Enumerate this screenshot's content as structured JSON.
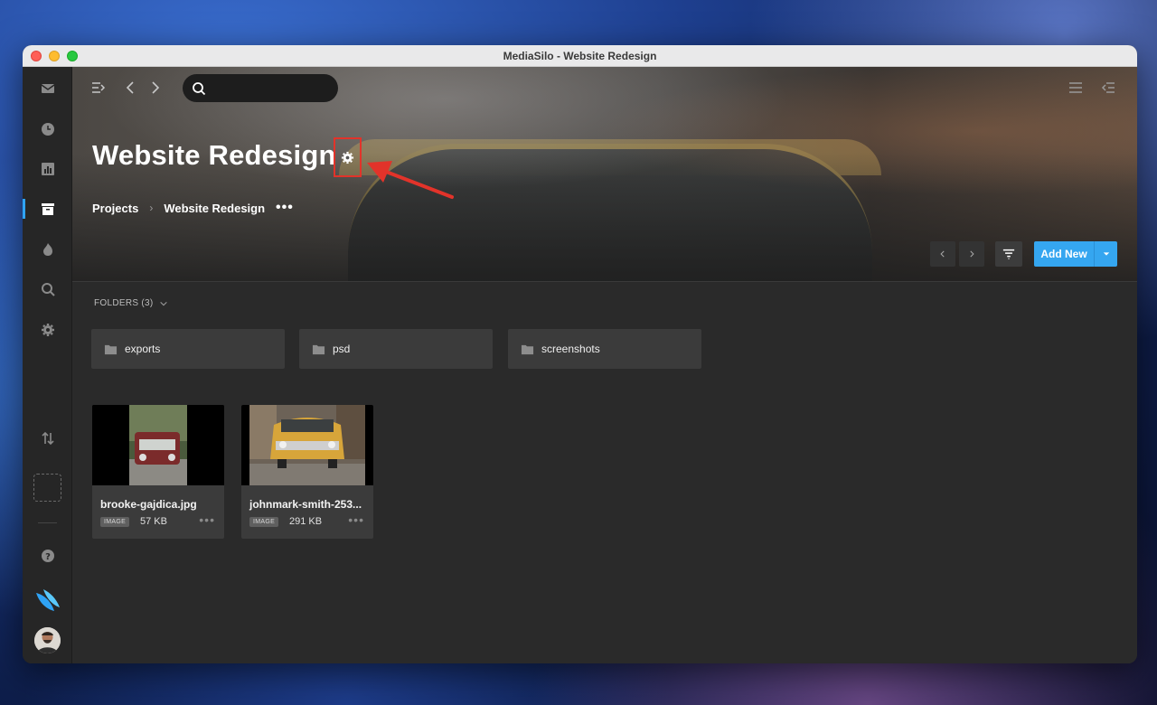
{
  "window": {
    "title": "MediaSilo - Website Redesign"
  },
  "sidebar": {
    "items": [
      {
        "icon": "inbox-icon"
      },
      {
        "icon": "clock-icon"
      },
      {
        "icon": "chart-icon"
      },
      {
        "icon": "projects-icon",
        "active": true
      },
      {
        "icon": "flame-icon"
      },
      {
        "icon": "search-icon"
      },
      {
        "icon": "gear-icon"
      },
      {
        "icon": "transfer-icon"
      },
      {
        "icon": "help-icon"
      },
      {
        "icon": "mediasilo-logo-icon"
      }
    ],
    "accent": "#2fa3f5"
  },
  "search": {
    "placeholder": ""
  },
  "project": {
    "title": "Website Redesign",
    "breadcrumb": [
      "Projects",
      "Website Redesign"
    ],
    "more": "•••"
  },
  "toolbar": {
    "add_label": "Add New",
    "add_color": "#35a6f0"
  },
  "folders": {
    "label": "FOLDERS (3)",
    "items": [
      {
        "name": "exports"
      },
      {
        "name": "psd"
      },
      {
        "name": "screenshots"
      }
    ]
  },
  "files": [
    {
      "name": "brooke-gajdica.jpg",
      "type": "IMAGE",
      "size": "57 KB"
    },
    {
      "name": "johnmark-smith-253...",
      "type": "IMAGE",
      "size": "291 KB"
    }
  ],
  "annotation": {
    "highlight_color": "#e2332a"
  }
}
